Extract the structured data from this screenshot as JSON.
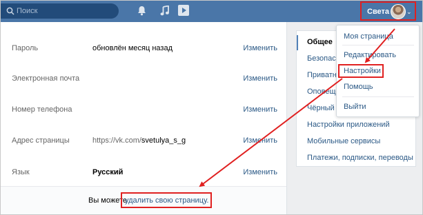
{
  "header": {
    "search_placeholder": "Поиск",
    "user_name": "Света",
    "icons": [
      "search-icon",
      "bell-icon",
      "music-icon",
      "video-icon",
      "chevron-down-icon"
    ]
  },
  "settings": {
    "rows": [
      {
        "label": "Пароль",
        "value": "обновлён месяц назад",
        "action": "Изменить"
      },
      {
        "label": "Электронная почта",
        "value": "",
        "action": "Изменить"
      },
      {
        "label": "Номер телефона",
        "value": "",
        "action": "Изменить"
      },
      {
        "label": "Адрес страницы",
        "value_prefix": "https://vk.com/",
        "value": "svetulya_s_g",
        "action": "Изменить"
      },
      {
        "label": "Язык",
        "value": "Русский",
        "action": "Изменить"
      }
    ],
    "footer_text": "Вы можете",
    "footer_link": "удалить свою страницу."
  },
  "sidebar": {
    "items": [
      {
        "label": "Общее",
        "active": true
      },
      {
        "label": "Безопасность"
      },
      {
        "label": "Приватность"
      },
      {
        "label": "Оповещения"
      },
      {
        "label": "Чёрный список"
      },
      {
        "label": "Настройки приложений"
      },
      {
        "label": "Мобильные сервисы"
      },
      {
        "label": "Платежи, подписки, переводы"
      }
    ]
  },
  "dropdown": {
    "items": [
      "Моя страница",
      "Редактировать",
      "Настройки",
      "Помощь",
      "Выйти"
    ]
  },
  "colors": {
    "header": "#4a76a8",
    "link": "#2a5885",
    "annotation": "#e02020"
  }
}
